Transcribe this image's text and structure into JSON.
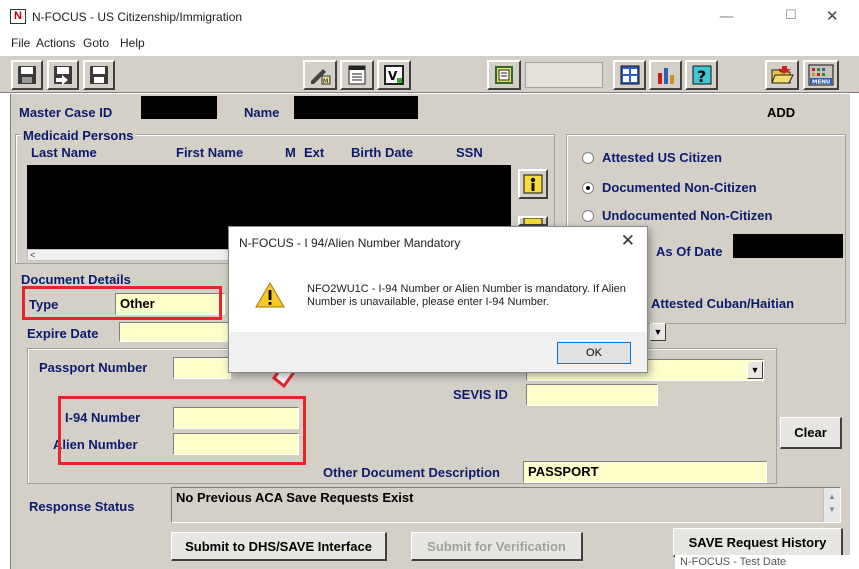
{
  "window": {
    "title": "N-FOCUS - US Citizenship/Immigration",
    "icon_letter": "N",
    "controls": {
      "minimize": "—",
      "maximize": "☐",
      "close": "✕"
    }
  },
  "menu": [
    "File",
    "Actions",
    "Goto",
    "Help"
  ],
  "toolbar": {
    "icons": [
      "save-icon",
      "save-close-icon",
      "save-new-icon",
      "pencil-icon",
      "notepad-icon",
      "verify-icon",
      "document-icon",
      "window-icon",
      "chart-icon",
      "help-icon",
      "open-folder-icon",
      "menu-icon"
    ],
    "menu_label": "MENU"
  },
  "header": {
    "master_case_label": "Master Case ID",
    "name_label": "Name",
    "mode": "ADD"
  },
  "medicaid": {
    "group_label": "Medicaid Persons",
    "columns": [
      "Last Name",
      "First Name",
      "M",
      "Ext",
      "Birth Date",
      "SSN"
    ],
    "scroll_left": "<"
  },
  "status_options": {
    "attested_us": "Attested US Citizen",
    "documented": "Documented Non-Citizen",
    "undocumented": "Undocumented Non-Citizen",
    "as_of_date": "As Of Date",
    "cuban": "Attested Cuban/Haitian",
    "selected": "documented"
  },
  "document": {
    "group_label": "Document Details",
    "type_label": "Type",
    "type_value": "Other",
    "expire_label": "Expire Date",
    "passport_label": "Passport Number",
    "sevis_label": "SEVIS ID",
    "i94_label": "I-94 Number",
    "alien_label": "Alien Number",
    "other_desc_label": "Other Document Description",
    "other_desc_value": "PASSPORT",
    "clear_label": "Clear"
  },
  "response": {
    "label": "Response Status",
    "value": "No Previous ACA Save Requests Exist"
  },
  "buttons": {
    "submit_dhs": "Submit to DHS/SAVE Interface",
    "submit_verify": "Submit for Verification",
    "save_history": "SAVE Request History"
  },
  "dialog": {
    "title": "N-FOCUS - I 94/Alien Number Mandatory",
    "message": "NFO2WU1C - I-94 Number or Alien Number is mandatory. If Alien Number is unavailable, please enter I-94 Number.",
    "ok": "OK",
    "close": "✕"
  },
  "tooltip": "N-FOCUS - Test Date",
  "colors": {
    "annotation_red": "#e8242c",
    "label_navy": "#0c1b6e",
    "field_yellow": "#ffffcc",
    "form_gray": "#d4d0c8"
  }
}
